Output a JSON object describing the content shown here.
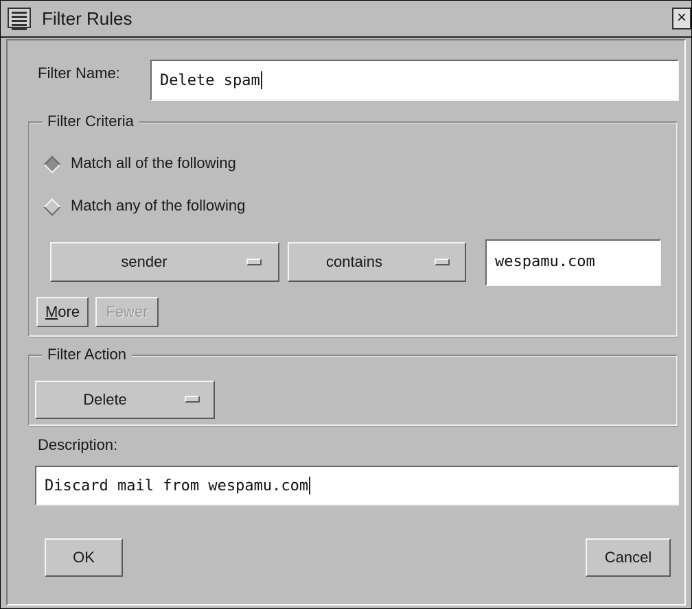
{
  "window": {
    "title": "Filter Rules",
    "close_glyph": "×"
  },
  "filter_name": {
    "label": "Filter Name:",
    "value": "Delete spam"
  },
  "criteria": {
    "group_title": "Filter Criteria",
    "radio_all": "Match all of the following",
    "radio_any": "Match any of the following",
    "selected": "all",
    "field_option": "sender",
    "operator_option": "contains",
    "value": "wespamu.com",
    "more_label": "More",
    "fewer_label": "Fewer"
  },
  "action": {
    "group_title": "Filter Action",
    "option": "Delete"
  },
  "description": {
    "label": "Description:",
    "value": "Discard mail from wespamu.com"
  },
  "buttons": {
    "ok": "OK",
    "cancel": "Cancel"
  },
  "icons": {
    "window_menu": "window-menu-icon",
    "close": "close-icon",
    "option_menu": "option-menu-indicator-icon",
    "radio": "diamond-radio-icon"
  },
  "colors": {
    "background": "#bdbdbd",
    "field": "#ffffff",
    "text": "#1a1a1a",
    "disabled_text": "#9a9a9a"
  }
}
